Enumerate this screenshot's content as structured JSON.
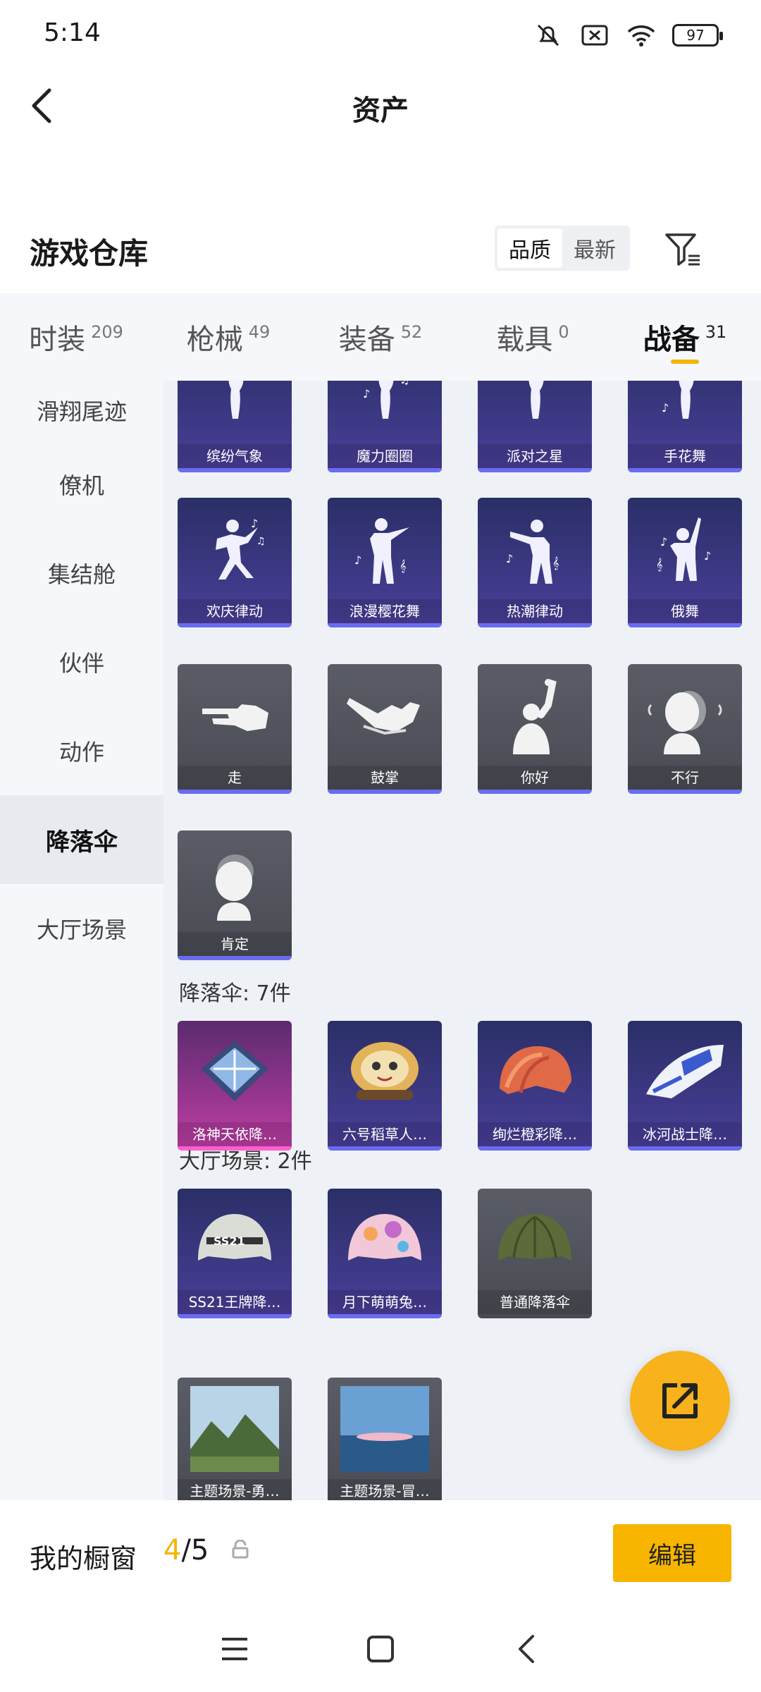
{
  "status": {
    "time": "5:14",
    "battery": "97"
  },
  "header": {
    "title": "资产"
  },
  "warehouse": {
    "title": "游戏仓库",
    "sort_quality": "品质",
    "sort_latest": "最新"
  },
  "categories": [
    {
      "label": "时装",
      "count": "209"
    },
    {
      "label": "枪械",
      "count": "49"
    },
    {
      "label": "装备",
      "count": "52"
    },
    {
      "label": "载具",
      "count": "0"
    },
    {
      "label": "战备",
      "count": "31"
    }
  ],
  "sidebar": {
    "items": [
      {
        "label": "滑翔尾迹"
      },
      {
        "label": "僚机"
      },
      {
        "label": "集结舱"
      },
      {
        "label": "伙伴"
      },
      {
        "label": "动作"
      },
      {
        "label": "降落伞"
      },
      {
        "label": "大厅场景"
      }
    ]
  },
  "actions": {
    "row1": [
      "缤纷气象",
      "魔力圈圈",
      "派对之星",
      "手花舞"
    ],
    "row2": [
      "欢庆律动",
      "浪漫樱花舞",
      "热潮律动",
      "俄舞"
    ],
    "row3": [
      "走",
      "鼓掌",
      "你好",
      "不行"
    ],
    "row4": [
      "肯定"
    ]
  },
  "parachute": {
    "section": "降落伞: 7件",
    "items": [
      "洛神天依降…",
      "六号稻草人…",
      "绚烂橙彩降…",
      "冰河战士降…",
      "SS21王牌降…",
      "月下萌萌兔…",
      "普通降落伞"
    ]
  },
  "lobby": {
    "section": "大厅场景: 2件",
    "items": [
      "主题场景-勇…",
      "主题场景-冒…"
    ]
  },
  "showcase": {
    "title": "我的橱窗",
    "current": "4",
    "total": "/5",
    "edit": "编辑"
  },
  "colors": {
    "accent": "#f5b40a",
    "card_purple": "#3b3585",
    "card_grey": "#52545c",
    "card_pink": "#c03ea5"
  }
}
